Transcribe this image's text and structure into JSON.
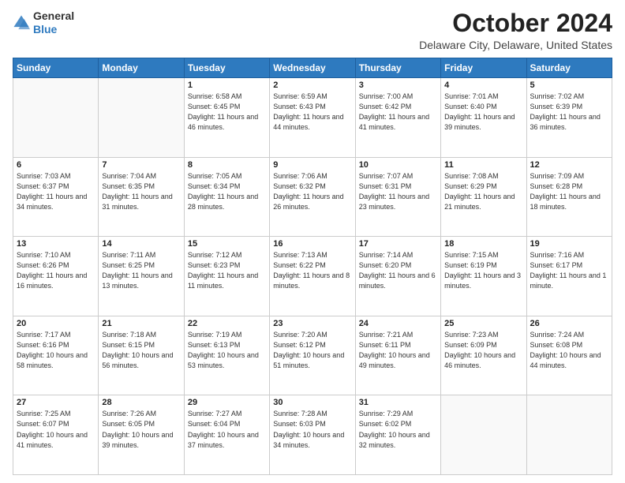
{
  "header": {
    "logo_general": "General",
    "logo_blue": "Blue",
    "month_title": "October 2024",
    "location": "Delaware City, Delaware, United States"
  },
  "calendar": {
    "days_of_week": [
      "Sunday",
      "Monday",
      "Tuesday",
      "Wednesday",
      "Thursday",
      "Friday",
      "Saturday"
    ],
    "weeks": [
      [
        {
          "day": "",
          "sunrise": "",
          "sunset": "",
          "daylight": ""
        },
        {
          "day": "",
          "sunrise": "",
          "sunset": "",
          "daylight": ""
        },
        {
          "day": "1",
          "sunrise": "Sunrise: 6:58 AM",
          "sunset": "Sunset: 6:45 PM",
          "daylight": "Daylight: 11 hours and 46 minutes."
        },
        {
          "day": "2",
          "sunrise": "Sunrise: 6:59 AM",
          "sunset": "Sunset: 6:43 PM",
          "daylight": "Daylight: 11 hours and 44 minutes."
        },
        {
          "day": "3",
          "sunrise": "Sunrise: 7:00 AM",
          "sunset": "Sunset: 6:42 PM",
          "daylight": "Daylight: 11 hours and 41 minutes."
        },
        {
          "day": "4",
          "sunrise": "Sunrise: 7:01 AM",
          "sunset": "Sunset: 6:40 PM",
          "daylight": "Daylight: 11 hours and 39 minutes."
        },
        {
          "day": "5",
          "sunrise": "Sunrise: 7:02 AM",
          "sunset": "Sunset: 6:39 PM",
          "daylight": "Daylight: 11 hours and 36 minutes."
        }
      ],
      [
        {
          "day": "6",
          "sunrise": "Sunrise: 7:03 AM",
          "sunset": "Sunset: 6:37 PM",
          "daylight": "Daylight: 11 hours and 34 minutes."
        },
        {
          "day": "7",
          "sunrise": "Sunrise: 7:04 AM",
          "sunset": "Sunset: 6:35 PM",
          "daylight": "Daylight: 11 hours and 31 minutes."
        },
        {
          "day": "8",
          "sunrise": "Sunrise: 7:05 AM",
          "sunset": "Sunset: 6:34 PM",
          "daylight": "Daylight: 11 hours and 28 minutes."
        },
        {
          "day": "9",
          "sunrise": "Sunrise: 7:06 AM",
          "sunset": "Sunset: 6:32 PM",
          "daylight": "Daylight: 11 hours and 26 minutes."
        },
        {
          "day": "10",
          "sunrise": "Sunrise: 7:07 AM",
          "sunset": "Sunset: 6:31 PM",
          "daylight": "Daylight: 11 hours and 23 minutes."
        },
        {
          "day": "11",
          "sunrise": "Sunrise: 7:08 AM",
          "sunset": "Sunset: 6:29 PM",
          "daylight": "Daylight: 11 hours and 21 minutes."
        },
        {
          "day": "12",
          "sunrise": "Sunrise: 7:09 AM",
          "sunset": "Sunset: 6:28 PM",
          "daylight": "Daylight: 11 hours and 18 minutes."
        }
      ],
      [
        {
          "day": "13",
          "sunrise": "Sunrise: 7:10 AM",
          "sunset": "Sunset: 6:26 PM",
          "daylight": "Daylight: 11 hours and 16 minutes."
        },
        {
          "day": "14",
          "sunrise": "Sunrise: 7:11 AM",
          "sunset": "Sunset: 6:25 PM",
          "daylight": "Daylight: 11 hours and 13 minutes."
        },
        {
          "day": "15",
          "sunrise": "Sunrise: 7:12 AM",
          "sunset": "Sunset: 6:23 PM",
          "daylight": "Daylight: 11 hours and 11 minutes."
        },
        {
          "day": "16",
          "sunrise": "Sunrise: 7:13 AM",
          "sunset": "Sunset: 6:22 PM",
          "daylight": "Daylight: 11 hours and 8 minutes."
        },
        {
          "day": "17",
          "sunrise": "Sunrise: 7:14 AM",
          "sunset": "Sunset: 6:20 PM",
          "daylight": "Daylight: 11 hours and 6 minutes."
        },
        {
          "day": "18",
          "sunrise": "Sunrise: 7:15 AM",
          "sunset": "Sunset: 6:19 PM",
          "daylight": "Daylight: 11 hours and 3 minutes."
        },
        {
          "day": "19",
          "sunrise": "Sunrise: 7:16 AM",
          "sunset": "Sunset: 6:17 PM",
          "daylight": "Daylight: 11 hours and 1 minute."
        }
      ],
      [
        {
          "day": "20",
          "sunrise": "Sunrise: 7:17 AM",
          "sunset": "Sunset: 6:16 PM",
          "daylight": "Daylight: 10 hours and 58 minutes."
        },
        {
          "day": "21",
          "sunrise": "Sunrise: 7:18 AM",
          "sunset": "Sunset: 6:15 PM",
          "daylight": "Daylight: 10 hours and 56 minutes."
        },
        {
          "day": "22",
          "sunrise": "Sunrise: 7:19 AM",
          "sunset": "Sunset: 6:13 PM",
          "daylight": "Daylight: 10 hours and 53 minutes."
        },
        {
          "day": "23",
          "sunrise": "Sunrise: 7:20 AM",
          "sunset": "Sunset: 6:12 PM",
          "daylight": "Daylight: 10 hours and 51 minutes."
        },
        {
          "day": "24",
          "sunrise": "Sunrise: 7:21 AM",
          "sunset": "Sunset: 6:11 PM",
          "daylight": "Daylight: 10 hours and 49 minutes."
        },
        {
          "day": "25",
          "sunrise": "Sunrise: 7:23 AM",
          "sunset": "Sunset: 6:09 PM",
          "daylight": "Daylight: 10 hours and 46 minutes."
        },
        {
          "day": "26",
          "sunrise": "Sunrise: 7:24 AM",
          "sunset": "Sunset: 6:08 PM",
          "daylight": "Daylight: 10 hours and 44 minutes."
        }
      ],
      [
        {
          "day": "27",
          "sunrise": "Sunrise: 7:25 AM",
          "sunset": "Sunset: 6:07 PM",
          "daylight": "Daylight: 10 hours and 41 minutes."
        },
        {
          "day": "28",
          "sunrise": "Sunrise: 7:26 AM",
          "sunset": "Sunset: 6:05 PM",
          "daylight": "Daylight: 10 hours and 39 minutes."
        },
        {
          "day": "29",
          "sunrise": "Sunrise: 7:27 AM",
          "sunset": "Sunset: 6:04 PM",
          "daylight": "Daylight: 10 hours and 37 minutes."
        },
        {
          "day": "30",
          "sunrise": "Sunrise: 7:28 AM",
          "sunset": "Sunset: 6:03 PM",
          "daylight": "Daylight: 10 hours and 34 minutes."
        },
        {
          "day": "31",
          "sunrise": "Sunrise: 7:29 AM",
          "sunset": "Sunset: 6:02 PM",
          "daylight": "Daylight: 10 hours and 32 minutes."
        },
        {
          "day": "",
          "sunrise": "",
          "sunset": "",
          "daylight": ""
        },
        {
          "day": "",
          "sunrise": "",
          "sunset": "",
          "daylight": ""
        }
      ]
    ]
  }
}
